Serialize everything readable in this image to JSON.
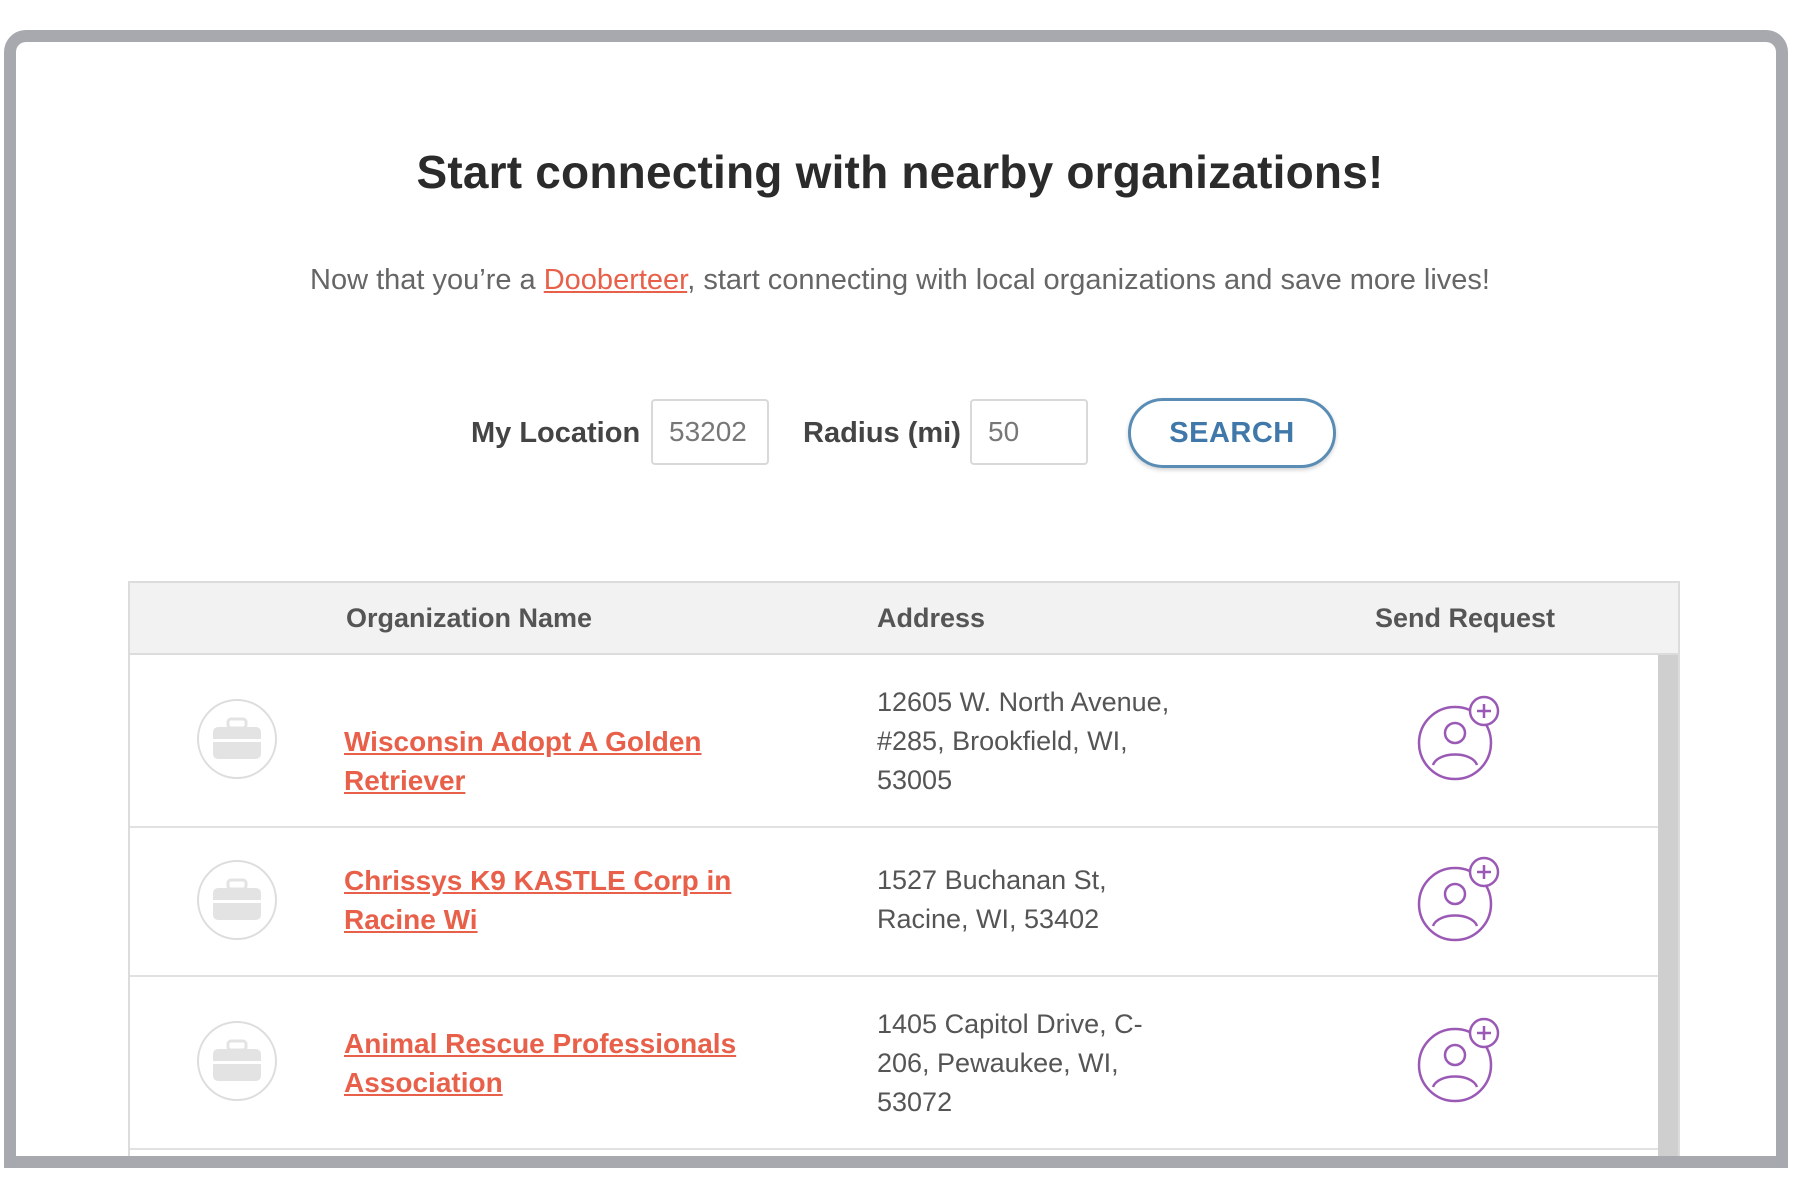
{
  "header": {
    "title": "Start connecting with nearby organizations!",
    "subtitle_before": "Now that you’re a ",
    "subtitle_link": "Dooberteer",
    "subtitle_after": ", start connecting with local organizations and save more lives!"
  },
  "search": {
    "location_label": "My Location",
    "location_value": "53202",
    "radius_label": "Radius (mi)",
    "radius_value": "50",
    "button_label": "SEARCH"
  },
  "table": {
    "columns": [
      "Organization Name",
      "Address",
      "Send Request"
    ],
    "rows": [
      {
        "name": "Wisconsin Adopt A Golden Retriever",
        "address": "12605 W. North Avenue, #285, Brookfield, WI, 53005"
      },
      {
        "name": "Chrissys K9 KASTLE Corp in Racine Wi",
        "address": "1527 Buchanan St, Racine, WI, 53402"
      },
      {
        "name": "Animal Rescue Professionals Association",
        "address": "1405 Capitol Drive, C-206, Pewaukee, WI, 53072"
      }
    ]
  },
  "icons": {
    "org_logo": "briefcase-icon",
    "send_request": "add-user-icon"
  },
  "colors": {
    "link": "#e8604a",
    "button": "#3f78a9",
    "request_icon": "#9b59b6",
    "frame": "#a7a9ae"
  }
}
